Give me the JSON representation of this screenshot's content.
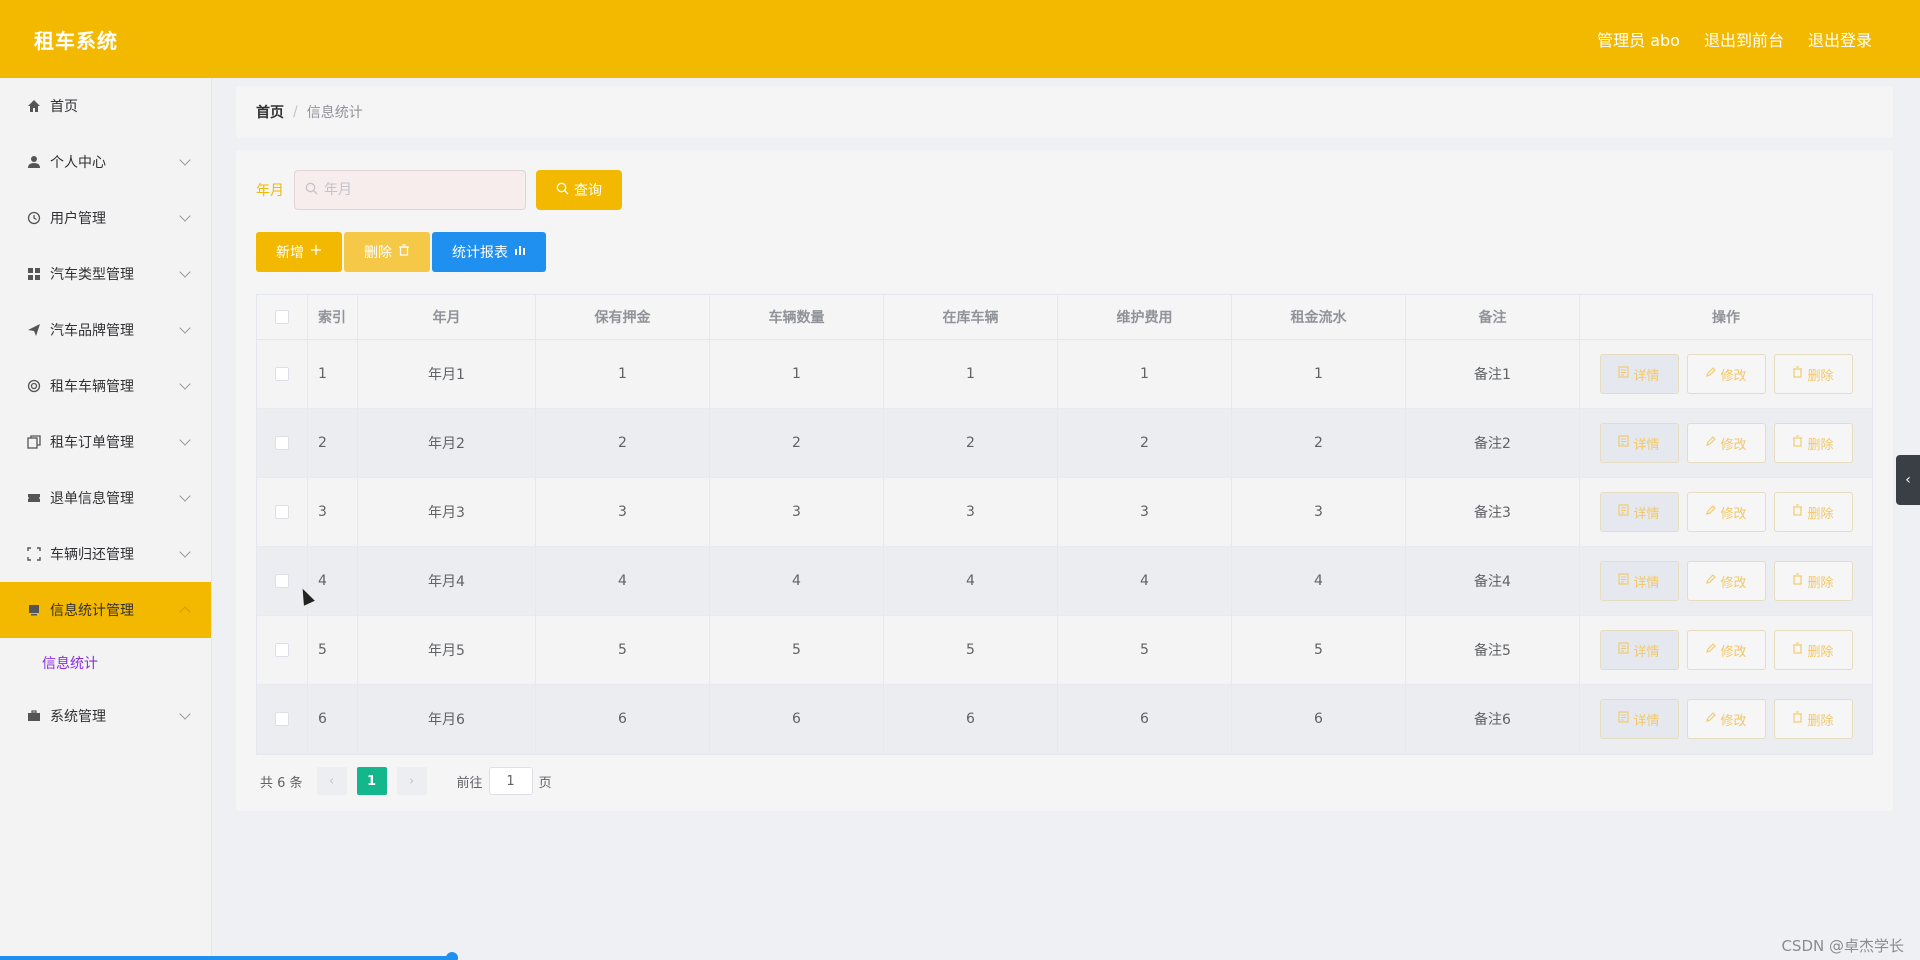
{
  "header": {
    "brand": "租车系统",
    "user": "管理员 abo",
    "to_front": "退出到前台",
    "logout": "退出登录"
  },
  "sidebar": {
    "items": [
      {
        "label": "首页",
        "icon": "home-icon"
      },
      {
        "label": "个人中心",
        "icon": "user-icon"
      },
      {
        "label": "用户管理",
        "icon": "clock-icon"
      },
      {
        "label": "汽车类型管理",
        "icon": "grid-icon"
      },
      {
        "label": "汽车品牌管理",
        "icon": "send-icon"
      },
      {
        "label": "租车车辆管理",
        "icon": "target-icon"
      },
      {
        "label": "租车订单管理",
        "icon": "copy-icon"
      },
      {
        "label": "退单信息管理",
        "icon": "ticket-icon"
      },
      {
        "label": "车辆归还管理",
        "icon": "frame-icon"
      },
      {
        "label": "信息统计管理",
        "icon": "monitor-icon"
      },
      {
        "label": "系统管理",
        "icon": "briefcase-icon"
      }
    ],
    "sub_item": "信息统计"
  },
  "breadcrumb": {
    "home": "首页",
    "separator": "/",
    "current": "信息统计"
  },
  "search": {
    "label": "年月",
    "placeholder": "年月",
    "button": "查询"
  },
  "actions": {
    "add": "新增",
    "delete": "删除",
    "report": "统计报表"
  },
  "table": {
    "columns": [
      "索引",
      "年月",
      "保有押金",
      "车辆数量",
      "在库车辆",
      "维护费用",
      "租金流水",
      "备注",
      "操作"
    ],
    "rows": [
      [
        "1",
        "年月1",
        "1",
        "1",
        "1",
        "1",
        "1",
        "备注1"
      ],
      [
        "2",
        "年月2",
        "2",
        "2",
        "2",
        "2",
        "2",
        "备注2"
      ],
      [
        "3",
        "年月3",
        "3",
        "3",
        "3",
        "3",
        "3",
        "备注3"
      ],
      [
        "4",
        "年月4",
        "4",
        "4",
        "4",
        "4",
        "4",
        "备注4"
      ],
      [
        "5",
        "年月5",
        "5",
        "5",
        "5",
        "5",
        "5",
        "备注5"
      ],
      [
        "6",
        "年月6",
        "6",
        "6",
        "6",
        "6",
        "6",
        "备注6"
      ]
    ],
    "op_detail": "详情",
    "op_edit": "修改",
    "op_delete": "删除"
  },
  "pager": {
    "total": "共 6 条",
    "current": "1",
    "goto_label": "前往",
    "goto_value": "1",
    "page_unit": "页"
  },
  "watermark": "CSDN @卓杰学长",
  "colors": {
    "primary": "#f3b800",
    "report": "#1f8ff0",
    "pager_active": "#13b78b",
    "submenu": "#8a2be2"
  }
}
